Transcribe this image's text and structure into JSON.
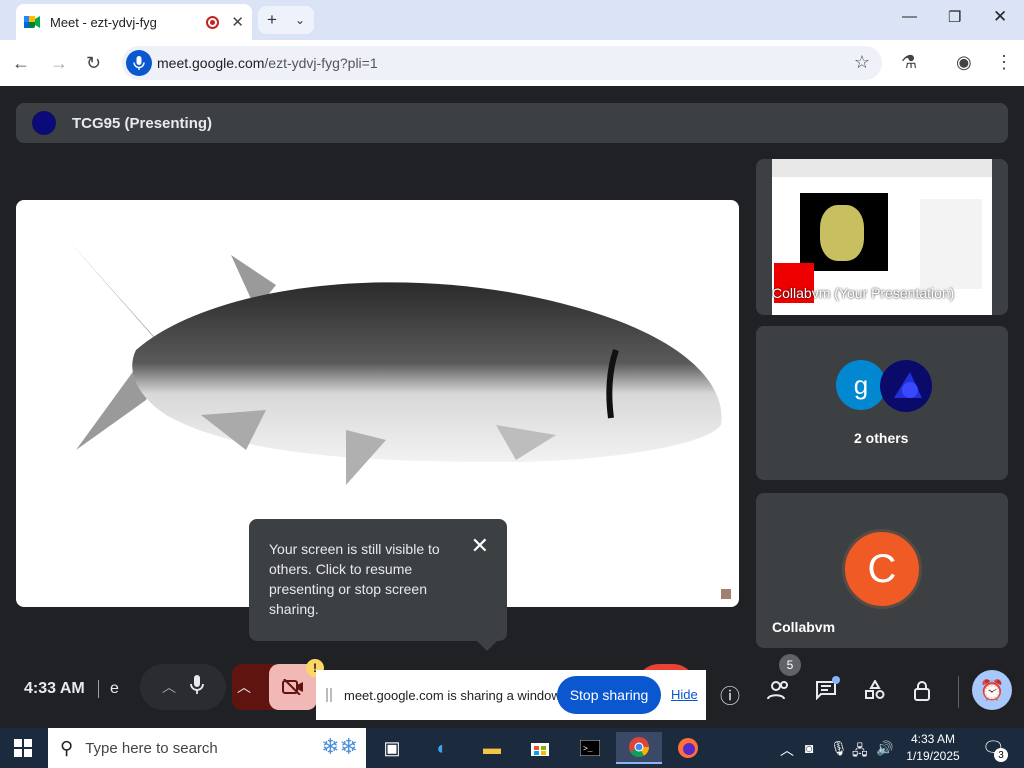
{
  "browser": {
    "tab_title": "Meet - ezt-ydvj-fyg",
    "url_host": "meet.google.com",
    "url_path": "/ezt-ydvj-fyg?pli=1"
  },
  "meet": {
    "presenter_label": "TCG95 (Presenting)",
    "tile_presentation_label": "Collabvm (Your Presentation)",
    "others_avatar_letter": "g",
    "others_label": "2 others",
    "self_avatar_letter": "C",
    "self_name": "Collabvm",
    "tooltip": {
      "message": "Your screen is still visible to others. Click to resume presenting or stop screen sharing.",
      "close_glyph": "✕"
    },
    "controls": {
      "time": "4:33 AM",
      "meeting_code_fragment": "e",
      "warning_glyph": "!",
      "people_count": "5"
    },
    "share_bar": {
      "message": "meet.google.com is sharing a window.",
      "stop_label": "Stop sharing",
      "hide_label": "Hide"
    },
    "colors": {
      "accent_blue": "#0b57d0",
      "self_avatar": "#f05a24",
      "others_avatar": "#0288d1"
    }
  },
  "taskbar": {
    "search_placeholder": "Type here to search",
    "time": "4:33 AM",
    "date": "1/19/2025",
    "notification_count": "3"
  }
}
